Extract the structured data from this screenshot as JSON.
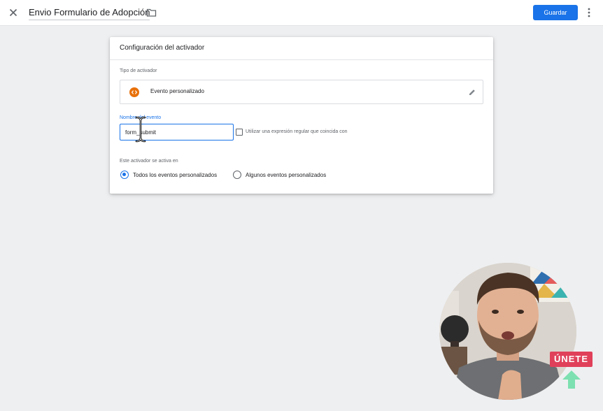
{
  "header": {
    "title": "Envio Formulario de Adopción",
    "save_label": "Guardar"
  },
  "card": {
    "title": "Configuración del activador",
    "trigger_type_label": "Tipo de activador",
    "trigger_type_name": "Evento personalizado",
    "event_name_label": "Nombre del evento",
    "event_name_value": "form_submit",
    "regex_label": "Utilizar una expresión regular que coincida con",
    "regex_checked": false,
    "fires_on_label": "Este activador se activa en",
    "fires_on_options": [
      {
        "label": "Todos los eventos personalizados",
        "selected": true
      },
      {
        "label": "Algunos eventos personalizados",
        "selected": false
      }
    ]
  },
  "overlay": {
    "join_label": "ÚNETE"
  },
  "colors": {
    "primary": "#1a73e8",
    "trigger_icon": "#e8710a",
    "join_badge": "#e0405a",
    "arrow": "#7de0b0"
  }
}
